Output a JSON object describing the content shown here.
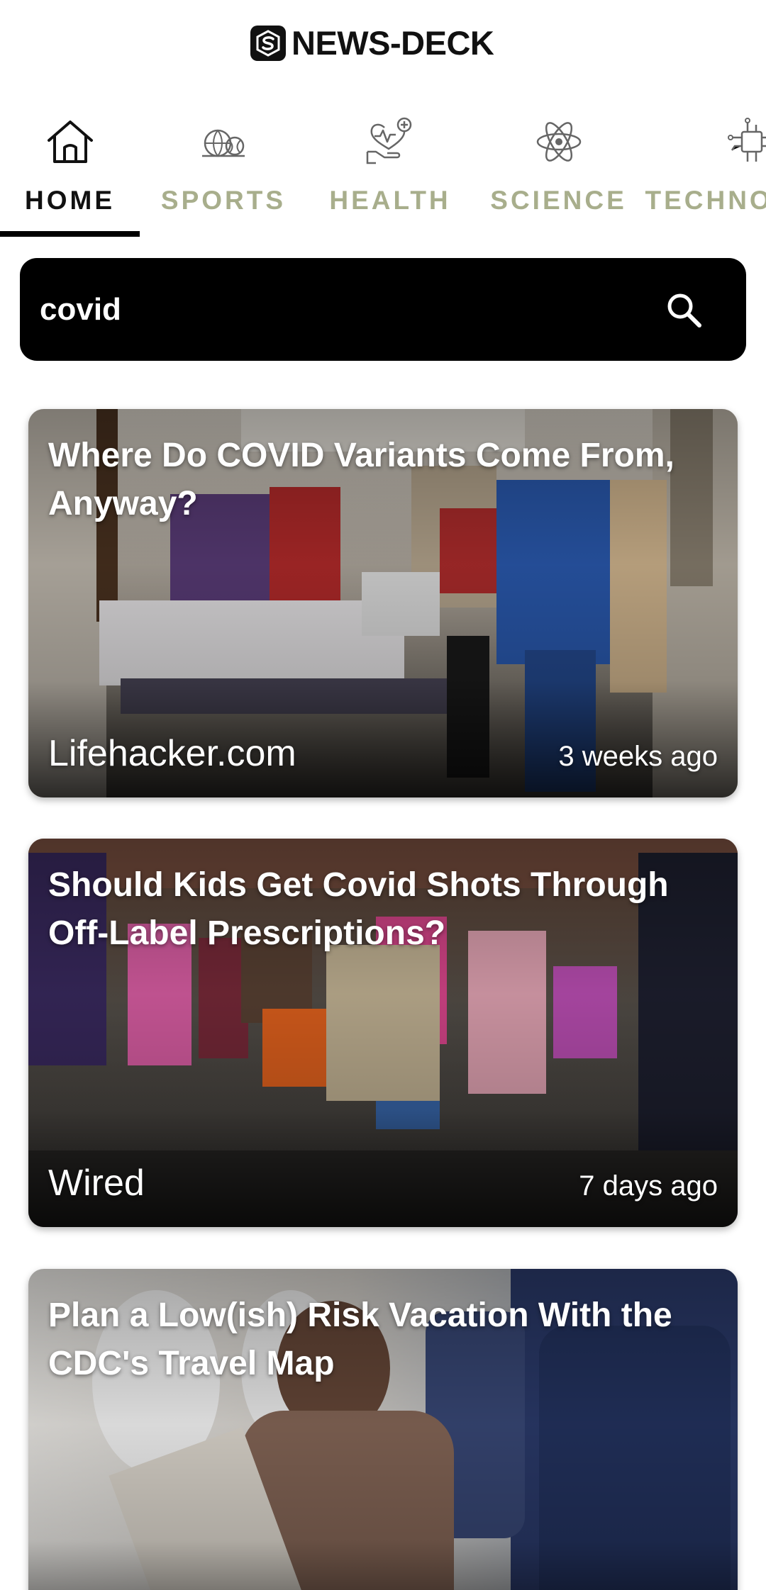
{
  "app": {
    "title": "NEWS-DECK"
  },
  "tabs": [
    {
      "label": "HOME",
      "icon": "home-icon",
      "active": true
    },
    {
      "label": "SPORTS",
      "icon": "sports-balls-icon",
      "active": false
    },
    {
      "label": "HEALTH",
      "icon": "health-hand-heart-icon",
      "active": false
    },
    {
      "label": "SCIENCE",
      "icon": "atom-icon",
      "active": false
    },
    {
      "label": "TECHNOLOGY",
      "icon": "circuit-chip-icon",
      "active": false
    }
  ],
  "search": {
    "value": "covid",
    "icon": "search-icon"
  },
  "articles": [
    {
      "title": "Where Do COVID Variants Come From, Anyway?",
      "source": "Lifehacker.com",
      "time": "3 weeks ago"
    },
    {
      "title": "Should Kids Get Covid Shots Through Off-Label Prescriptions?",
      "source": "Wired",
      "time": "7 days ago"
    },
    {
      "title": "Plan a Low(ish) Risk Vacation With the CDC's Travel Map",
      "source": "",
      "time": ""
    }
  ],
  "colors": {
    "active_tab": "#111111",
    "inactive_tab": "#a8ae8c",
    "search_bg": "#000000",
    "card_text": "#ffffff"
  }
}
